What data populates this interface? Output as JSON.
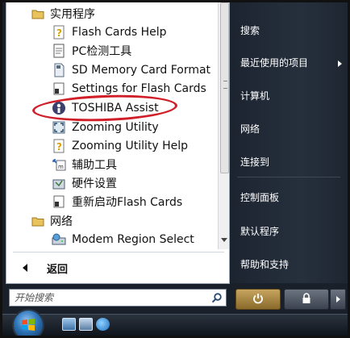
{
  "programs": {
    "items": [
      {
        "label": "实用程序",
        "icon": "folder-icon"
      },
      {
        "label": "Flash Cards Help",
        "icon": "help-document-icon"
      },
      {
        "label": "PC检测工具",
        "icon": "document-icon"
      },
      {
        "label": "SD Memory Card Format",
        "icon": "sd-card-format-icon"
      },
      {
        "label": "Settings for Flash Cards",
        "icon": "flash-cards-settings-icon"
      },
      {
        "label": "TOSHIBA Assist",
        "icon": "toshiba-assist-icon"
      },
      {
        "label": "Zooming Utility",
        "icon": "zoom-icon"
      },
      {
        "label": "Zooming Utility Help",
        "icon": "help-document-icon"
      },
      {
        "label": "辅助工具",
        "icon": "tools-icon"
      },
      {
        "label": "硬件设置",
        "icon": "hardware-settings-icon"
      },
      {
        "label": "重新启动Flash Cards",
        "icon": "flash-cards-icon"
      },
      {
        "label": "网络",
        "icon": "folder-icon"
      },
      {
        "label": "Modem Region Select",
        "icon": "modem-icon"
      }
    ],
    "highlighted_item": "TOSHIBA Assist",
    "back_label": "返回"
  },
  "search": {
    "placeholder": "开始搜索"
  },
  "right_menu": {
    "items": [
      {
        "label": "搜索"
      },
      {
        "label": "最近使用的项目",
        "has_submenu": true
      },
      {
        "label": "计算机"
      },
      {
        "label": "网络"
      },
      {
        "label": "连接到"
      },
      {
        "label": "控制面板"
      },
      {
        "label": "默认程序"
      },
      {
        "label": "帮助和支持"
      }
    ]
  },
  "power": {
    "power_icon": "power-icon",
    "lock_icon": "lock-icon",
    "more_icon": "arrow-right-icon"
  },
  "colors": {
    "highlight_ellipse": "#d11f2a",
    "right_panel_bg": "#222b36",
    "power_button": "#b08a45"
  }
}
